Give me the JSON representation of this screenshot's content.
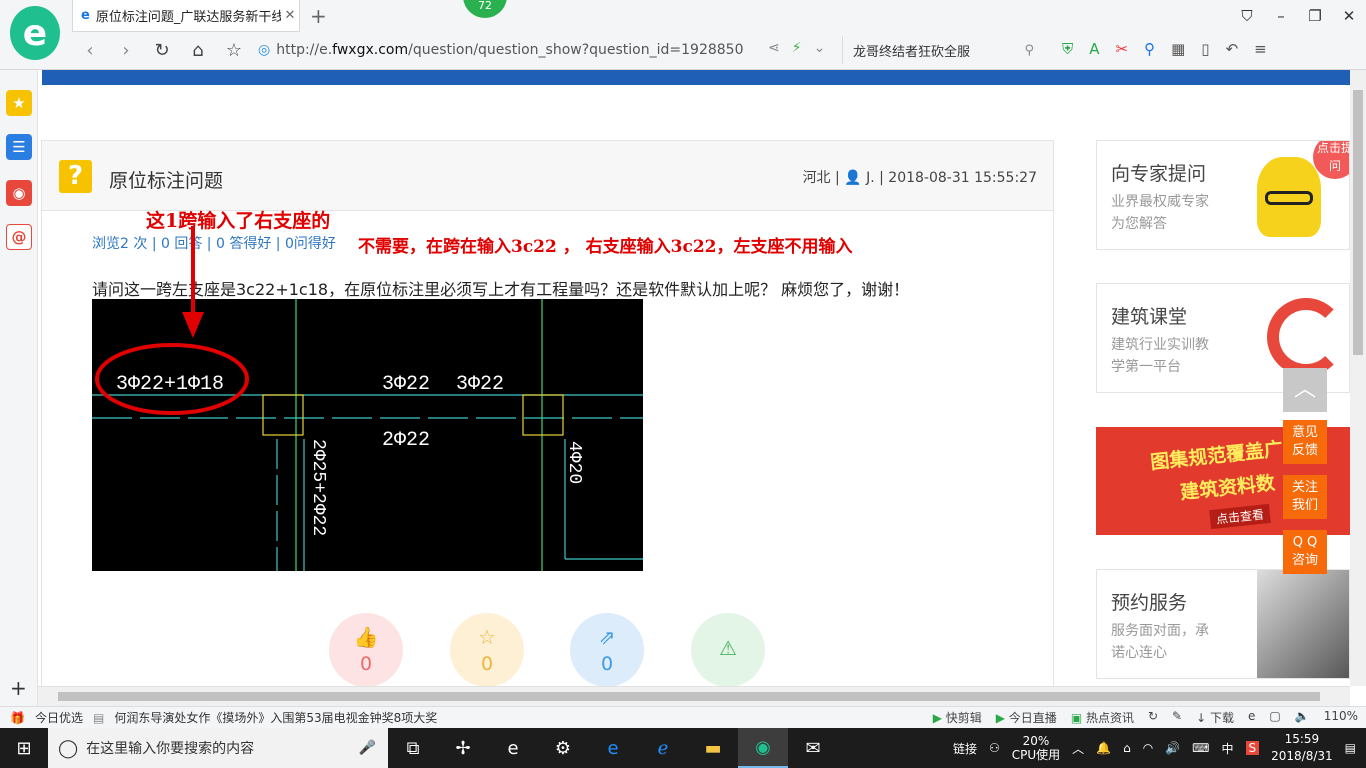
{
  "browser": {
    "tab_title": "原位标注问题_广联达服务新干线",
    "badge_count": "72",
    "url_prefix": "http://e.",
    "url_host": "fwxgx.com",
    "url_path": "/question/question_show?question_id=1928850",
    "search_text": "龙哥终结者狂砍全服"
  },
  "question": {
    "title": "原位标注问题",
    "region": "河北",
    "user": "J.",
    "datetime": "2018-08-31 15:55:27",
    "stats": {
      "views": "浏览2 次",
      "answers": "0 回答",
      "good": "0 答得好",
      "asked_good": "0问得好"
    },
    "body": "请问这一跨左支座是3c22+1c18，在原位标注里必须写上才有工程量吗？还是软件默认加上呢？ 麻烦您了，谢谢！",
    "annotation_1": "这1跨输入了右支座的",
    "annotation_2": "不需要，在跨在输入3c22 ， 右支座输入3c22，左支座不用输入",
    "cad": {
      "label_left": "3Φ22+1Φ18",
      "label_mid": "3Φ22",
      "label_right": "3Φ22",
      "label_bottom": "2Φ22",
      "label_vertical_1": "2Φ25+2Φ22",
      "label_vertical_2": "4Φ20"
    },
    "actions": [
      {
        "name": "like",
        "count": "0",
        "color": "#fde3e3",
        "icon_color": "#f06a6a"
      },
      {
        "name": "favorite",
        "count": "0",
        "color": "#fdf0d5",
        "icon_color": "#f0b63c"
      },
      {
        "name": "share",
        "count": "0",
        "color": "#dcecfb",
        "icon_color": "#3b9be6"
      },
      {
        "name": "report",
        "count": "",
        "color": "#e3f5e6",
        "icon_color": "#46b35c"
      }
    ]
  },
  "sidebar_right": {
    "expert": {
      "title": "向专家提问",
      "line1": "业界最权威专家",
      "line2": "为您解答",
      "bubble": "点击提问"
    },
    "course": {
      "title": "建筑课堂",
      "line1": "建筑行业实训教",
      "line2": "学第一平台"
    },
    "promo": {
      "line1": "图集规范覆盖广",
      "line2": "建筑资料数",
      "button": "点击查看"
    },
    "service": {
      "title": "预约服务",
      "line1": "服务面对面，承",
      "line2": "诺心连心"
    },
    "float_buttons": [
      {
        "l1": "意见",
        "l2": "反馈"
      },
      {
        "l1": "关注",
        "l2": "我们"
      },
      {
        "l1": "Q Q",
        "l2": "咨询"
      }
    ]
  },
  "statusbar": {
    "left1": "今日优选",
    "news": "何润东导演处女作《摸场外》入围第53届电视金钟奖8项大奖",
    "r1": "快剪辑",
    "r2": "今日直播",
    "r3": "热点资讯",
    "r4": "下载",
    "zoom": "110%"
  },
  "taskbar": {
    "search_placeholder": "在这里输入你要搜索的内容",
    "link_label": "链接",
    "cpu_percent": "20%",
    "cpu_label": "CPU使用",
    "ime": "中",
    "time": "15:59",
    "date": "2018/8/31"
  },
  "colors": {
    "accent_blue": "#1f5fb5",
    "annotation_red": "#e00000",
    "orange": "#f66a0a"
  }
}
